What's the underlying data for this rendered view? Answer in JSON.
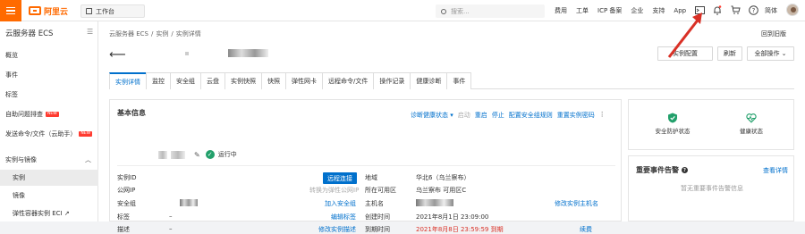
{
  "topbar": {
    "logo_text": "阿里云",
    "workbench_label": "工作台",
    "search_placeholder": "搜索...",
    "links": [
      "费用",
      "工单",
      "ICP 备案",
      "企业",
      "支持",
      "App"
    ],
    "language": "简体",
    "brand_color": "#ff6a00"
  },
  "sidebar": {
    "title": "云服务器 ECS",
    "items": [
      {
        "label": "概览"
      },
      {
        "label": "事件"
      },
      {
        "label": "标签"
      },
      {
        "label": "自助问题排查",
        "badge": "NEW"
      },
      {
        "label": "发送命令/文件（云助手）",
        "badge": "NEW"
      }
    ],
    "group": {
      "label": "实例与镜像"
    },
    "group_items": [
      {
        "label": "实例",
        "active": true
      },
      {
        "label": "镜像"
      },
      {
        "label": "弹性容器实例 ECI ↗"
      }
    ]
  },
  "main": {
    "breadcrumb": [
      "云服务器 ECS",
      "/",
      "实例",
      "/",
      "实例详情"
    ],
    "back_old": "回到旧版",
    "buttons": {
      "config": "实例配置",
      "refresh": "刷新",
      "all_actions": "全部操作 ⌄"
    },
    "tabs": [
      "实例详情",
      "监控",
      "安全组",
      "云盘",
      "实例快照",
      "快照",
      "弹性网卡",
      "远程命令/文件",
      "操作记录",
      "健康诊断",
      "事件"
    ],
    "active_tab": "实例详情"
  },
  "basic": {
    "title": "基本信息",
    "actions": [
      "诊断健康状态 ▾",
      "启动",
      "重启",
      "停止",
      "配置安全组规则",
      "重置实例密码",
      "⋮"
    ],
    "status": "运行中",
    "labels": {
      "id": "实例ID",
      "public_ip": "公网IP",
      "sg": "安全组",
      "tag": "标签",
      "desc": "描述",
      "region": "地域",
      "zone": "所在可用区",
      "hostname": "主机名",
      "created": "创建时间",
      "expire": "到期时间"
    },
    "values": {
      "convert_eip": "转换为弹性公网IP",
      "join_sg": "加入安全组",
      "tag": "–",
      "edit_tag": "编辑标签",
      "desc": "–",
      "edit_desc": "修改实例描述",
      "remote": "远程连接",
      "region": "华北6（乌兰察布）",
      "zone": "乌兰察布 可用区C",
      "edit_hostname": "修改实例主机名",
      "created": "2021年8月1日 23:09:00",
      "expire": "2021年8月8日 23:59:59 到期",
      "renew": "续费"
    }
  },
  "right": {
    "security_label": "安全防护状态",
    "health_label": "健康状态",
    "events_title": "重要事件告警",
    "events_link": "查看详情",
    "events_empty": "暂无重要事件告警信息"
  }
}
